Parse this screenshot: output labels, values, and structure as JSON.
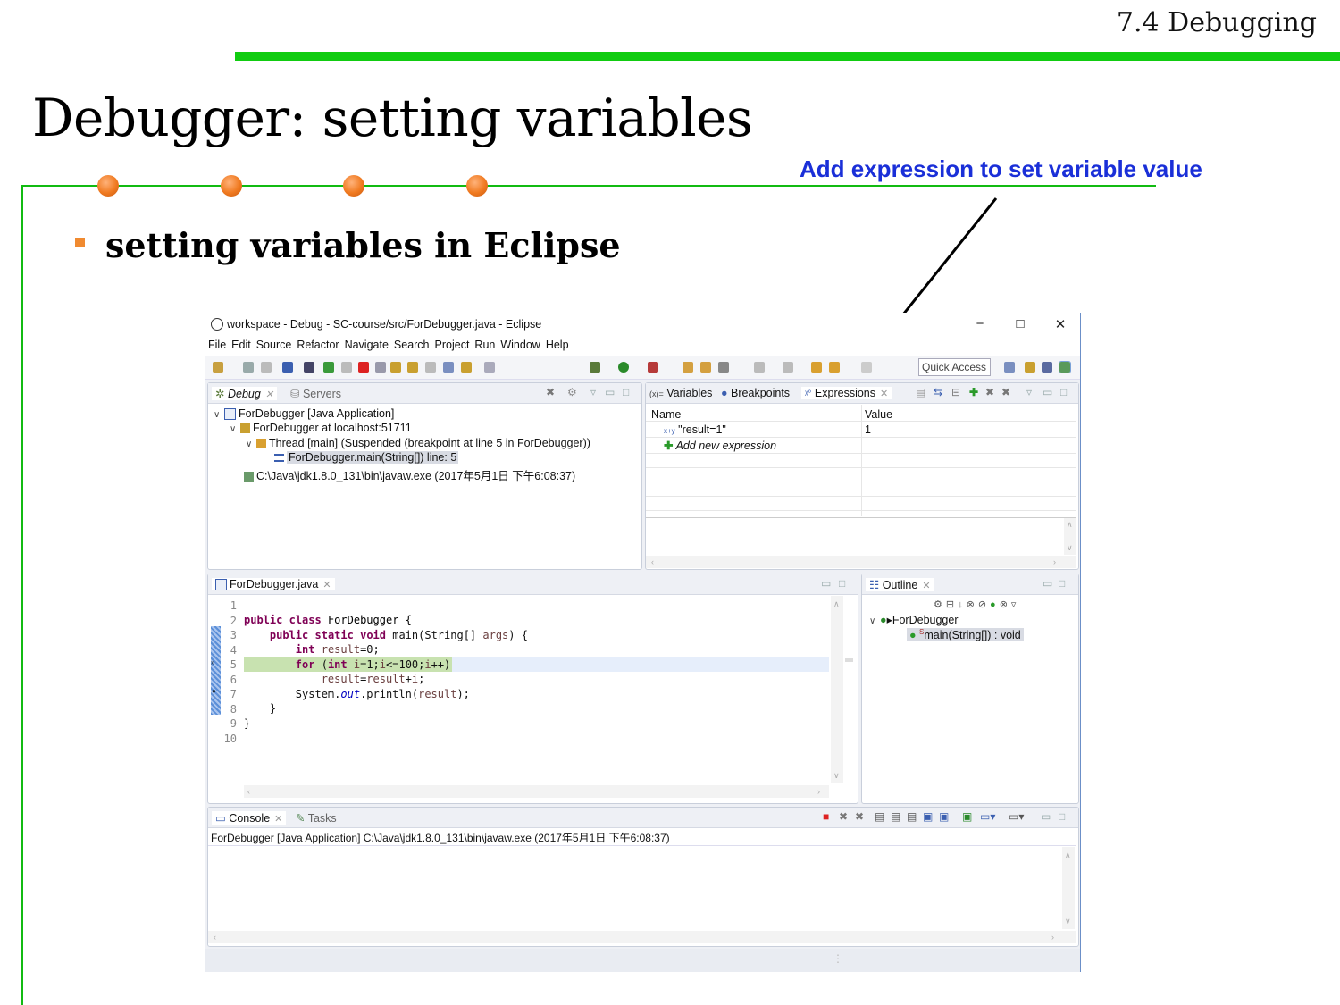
{
  "slide": {
    "section": "7.4 Debugging",
    "title": "Debugger: setting variables",
    "annotation": "Add expression to set variable value",
    "bullet": "setting variables in Eclipse"
  },
  "colors": {
    "accent_green": "#11cc11",
    "annotation_blue": "#1a2fd8",
    "bullet_orange": "#f08a30"
  },
  "eclipse": {
    "window_title": "workspace - Debug - SC-course/src/ForDebugger.java - Eclipse",
    "window_buttons": [
      "−",
      "□",
      "✕"
    ],
    "menu": [
      "File",
      "Edit",
      "Source",
      "Refactor",
      "Navigate",
      "Search",
      "Project",
      "Run",
      "Window",
      "Help"
    ],
    "quick_access": "Quick Access",
    "debug_panel": {
      "tabs": [
        "Debug",
        "Servers"
      ],
      "tree": [
        "ForDebugger [Java Application]",
        "ForDebugger at localhost:51711",
        "Thread [main] (Suspended (breakpoint at line 5 in ForDebugger))",
        "ForDebugger.main(String[]) line: 5",
        "C:\\Java\\jdk1.8.0_131\\bin\\javaw.exe (2017年5月1日 下午6:08:37)"
      ]
    },
    "expressions_panel": {
      "tabs": [
        "Variables",
        "Breakpoints",
        "Expressions"
      ],
      "tab_prefix": "(x)=",
      "columns": [
        "Name",
        "Value"
      ],
      "rows": [
        {
          "name": "\"result=1\"",
          "value": "1"
        }
      ],
      "add_new": "Add new expression"
    },
    "editor": {
      "tab": "ForDebugger.java",
      "line_numbers": [
        "1",
        "2",
        "3",
        "4",
        "5",
        "6",
        "7",
        "8",
        "9",
        "10"
      ],
      "current_line": 5
    },
    "outline": {
      "tab": "Outline",
      "class_name": "ForDebugger",
      "method": "main(String[]) : void"
    },
    "console": {
      "tabs": [
        "Console",
        "Tasks"
      ],
      "header": "ForDebugger [Java Application] C:\\Java\\jdk1.8.0_131\\bin\\javaw.exe (2017年5月1日 下午6:08:37)"
    }
  }
}
